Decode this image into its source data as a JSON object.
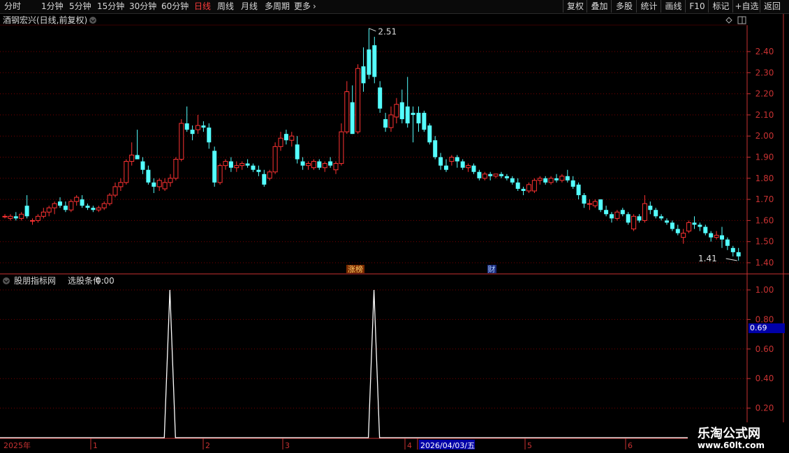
{
  "toolbar": {
    "periods": [
      "分时",
      "1分钟",
      "5分钟",
      "15分钟",
      "30分钟",
      "60分钟",
      "日线",
      "周线",
      "月线",
      "多周期",
      "更多"
    ],
    "active": "日线",
    "more_icon": "chevron-right-icon",
    "right_buttons": [
      "复权",
      "叠加",
      "多股",
      "统计",
      "画线",
      "F10",
      "标记",
      "+自选",
      "返回"
    ]
  },
  "main_panel": {
    "title": "酒钢宏兴(日线,前复权)",
    "title_icon": "chevron-down-icon",
    "controls": [
      "diamond-icon",
      "panel-toggle-icon"
    ],
    "y_ticks": [
      "2.40",
      "2.30",
      "2.20",
      "2.10",
      "2.00",
      "1.90",
      "1.80",
      "1.70",
      "1.60",
      "1.50",
      "1.40"
    ],
    "high_label": "2.51",
    "low_label": "1.41",
    "event_tags": [
      "涨榜",
      "财"
    ],
    "colors": {
      "up": "#ff3232",
      "down": "#54ffff",
      "grid": "#7a0000",
      "axis": "#c83232"
    }
  },
  "indicator_panel": {
    "title": "股朋指标网",
    "condition_label": "选股条件:",
    "condition_value": "0.00",
    "y_ticks": [
      "1.00",
      "0.80",
      "0.60",
      "0.40",
      "0.20"
    ],
    "crosshair_value": "0.69"
  },
  "time_axis": {
    "labels": [
      "2025年",
      "1",
      "2",
      "3",
      "4",
      "2026/04/03/五",
      "5",
      "6"
    ]
  },
  "watermark": {
    "title": "乐淘公式网",
    "url": "www.60lt.com"
  },
  "chart_data": [
    {
      "type": "candlestick",
      "title": "酒钢宏兴(日线,前复权)",
      "ylim": [
        1.37,
        2.52
      ],
      "high": 2.51,
      "low": 1.41,
      "candles": [
        [
          1.62,
          1.63,
          1.61,
          1.62
        ],
        [
          1.61,
          1.63,
          1.6,
          1.62
        ],
        [
          1.62,
          1.64,
          1.6,
          1.61
        ],
        [
          1.61,
          1.64,
          1.6,
          1.63
        ],
        [
          1.67,
          1.72,
          1.61,
          1.62
        ],
        [
          1.6,
          1.61,
          1.58,
          1.6
        ],
        [
          1.6,
          1.63,
          1.59,
          1.62
        ],
        [
          1.62,
          1.66,
          1.61,
          1.64
        ],
        [
          1.64,
          1.67,
          1.62,
          1.66
        ],
        [
          1.66,
          1.69,
          1.63,
          1.68
        ],
        [
          1.69,
          1.71,
          1.66,
          1.67
        ],
        [
          1.67,
          1.69,
          1.64,
          1.65
        ],
        [
          1.65,
          1.7,
          1.64,
          1.69
        ],
        [
          1.69,
          1.72,
          1.67,
          1.71
        ],
        [
          1.7,
          1.72,
          1.66,
          1.67
        ],
        [
          1.67,
          1.68,
          1.65,
          1.66
        ],
        [
          1.66,
          1.67,
          1.64,
          1.65
        ],
        [
          1.65,
          1.67,
          1.64,
          1.66
        ],
        [
          1.66,
          1.69,
          1.65,
          1.68
        ],
        [
          1.68,
          1.73,
          1.67,
          1.72
        ],
        [
          1.72,
          1.78,
          1.71,
          1.76
        ],
        [
          1.76,
          1.8,
          1.74,
          1.78
        ],
        [
          1.78,
          1.89,
          1.77,
          1.88
        ],
        [
          1.88,
          1.97,
          1.86,
          1.91
        ],
        [
          1.91,
          2.03,
          1.9,
          1.89
        ],
        [
          1.88,
          1.9,
          1.82,
          1.84
        ],
        [
          1.84,
          1.86,
          1.77,
          1.78
        ],
        [
          1.78,
          1.8,
          1.73,
          1.76
        ],
        [
          1.76,
          1.8,
          1.74,
          1.79
        ],
        [
          1.75,
          1.8,
          1.74,
          1.78
        ],
        [
          1.78,
          1.82,
          1.76,
          1.8
        ],
        [
          1.8,
          1.9,
          1.79,
          1.89
        ],
        [
          1.89,
          2.08,
          1.88,
          2.06
        ],
        [
          2.06,
          2.14,
          2.02,
          2.03
        ],
        [
          2.03,
          2.05,
          1.98,
          2.01
        ],
        [
          2.03,
          2.1,
          2.01,
          2.05
        ],
        [
          2.05,
          2.07,
          2.02,
          2.04
        ],
        [
          2.04,
          2.06,
          1.94,
          1.97
        ],
        [
          1.93,
          1.95,
          1.76,
          1.78
        ],
        [
          1.78,
          1.87,
          1.77,
          1.86
        ],
        [
          1.86,
          1.89,
          1.84,
          1.88
        ],
        [
          1.88,
          1.9,
          1.83,
          1.85
        ],
        [
          1.85,
          1.88,
          1.83,
          1.86
        ],
        [
          1.86,
          1.88,
          1.84,
          1.87
        ],
        [
          1.87,
          1.89,
          1.85,
          1.86
        ],
        [
          1.86,
          1.87,
          1.83,
          1.84
        ],
        [
          1.84,
          1.86,
          1.81,
          1.83
        ],
        [
          1.82,
          1.84,
          1.76,
          1.77
        ],
        [
          1.8,
          1.84,
          1.79,
          1.83
        ],
        [
          1.83,
          1.97,
          1.82,
          1.95
        ],
        [
          1.95,
          2.02,
          1.93,
          1.99
        ],
        [
          2.01,
          2.03,
          1.96,
          1.98
        ],
        [
          1.98,
          2.02,
          1.95,
          2.0
        ],
        [
          1.96,
          2.0,
          1.87,
          1.89
        ],
        [
          1.88,
          1.9,
          1.84,
          1.86
        ],
        [
          1.86,
          1.88,
          1.84,
          1.87
        ],
        [
          1.85,
          1.89,
          1.84,
          1.88
        ],
        [
          1.88,
          1.89,
          1.84,
          1.85
        ],
        [
          1.85,
          1.88,
          1.83,
          1.87
        ],
        [
          1.88,
          1.9,
          1.85,
          1.86
        ],
        [
          1.84,
          1.88,
          1.82,
          1.87
        ],
        [
          1.87,
          2.06,
          1.86,
          2.02
        ],
        [
          2.02,
          2.26,
          2.01,
          2.21
        ],
        [
          2.16,
          2.24,
          2.01,
          2.01
        ],
        [
          2.02,
          2.34,
          2.01,
          2.32
        ],
        [
          2.33,
          2.42,
          2.21,
          2.25
        ],
        [
          2.41,
          2.51,
          2.27,
          2.29
        ],
        [
          2.43,
          2.47,
          2.25,
          2.28
        ],
        [
          2.23,
          2.26,
          2.11,
          2.13
        ],
        [
          2.08,
          2.11,
          2.02,
          2.04
        ],
        [
          2.04,
          2.14,
          2.02,
          2.1
        ],
        [
          2.09,
          2.18,
          2.06,
          2.15
        ],
        [
          2.16,
          2.22,
          2.06,
          2.08
        ],
        [
          2.14,
          2.28,
          2.04,
          2.06
        ],
        [
          2.11,
          2.14,
          1.97,
          2.1
        ],
        [
          2.11,
          2.14,
          2.02,
          2.06
        ],
        [
          2.11,
          2.12,
          2.02,
          2.03
        ],
        [
          2.05,
          2.06,
          1.96,
          1.97
        ],
        [
          1.98,
          2.0,
          1.89,
          1.9
        ],
        [
          1.9,
          1.92,
          1.84,
          1.86
        ],
        [
          1.86,
          1.89,
          1.83,
          1.84
        ],
        [
          1.88,
          1.91,
          1.86,
          1.9
        ],
        [
          1.9,
          1.91,
          1.85,
          1.88
        ],
        [
          1.88,
          1.89,
          1.84,
          1.85
        ],
        [
          1.85,
          1.87,
          1.83,
          1.86
        ],
        [
          1.86,
          1.87,
          1.82,
          1.83
        ],
        [
          1.83,
          1.84,
          1.79,
          1.8
        ],
        [
          1.8,
          1.83,
          1.79,
          1.82
        ],
        [
          1.82,
          1.83,
          1.79,
          1.81
        ],
        [
          1.81,
          1.82,
          1.8,
          1.82
        ],
        [
          1.82,
          1.83,
          1.8,
          1.81
        ],
        [
          1.81,
          1.82,
          1.79,
          1.8
        ],
        [
          1.8,
          1.81,
          1.77,
          1.78
        ],
        [
          1.78,
          1.8,
          1.74,
          1.75
        ],
        [
          1.75,
          1.76,
          1.72,
          1.74
        ],
        [
          1.74,
          1.78,
          1.73,
          1.77
        ],
        [
          1.74,
          1.8,
          1.73,
          1.79
        ],
        [
          1.79,
          1.81,
          1.77,
          1.8
        ],
        [
          1.8,
          1.81,
          1.77,
          1.78
        ],
        [
          1.78,
          1.81,
          1.77,
          1.8
        ],
        [
          1.8,
          1.82,
          1.78,
          1.79
        ],
        [
          1.79,
          1.82,
          1.78,
          1.81
        ],
        [
          1.81,
          1.84,
          1.78,
          1.79
        ],
        [
          1.79,
          1.81,
          1.75,
          1.76
        ],
        [
          1.77,
          1.78,
          1.7,
          1.72
        ],
        [
          1.72,
          1.73,
          1.66,
          1.68
        ],
        [
          1.68,
          1.7,
          1.65,
          1.68
        ],
        [
          1.67,
          1.7,
          1.66,
          1.69
        ],
        [
          1.7,
          1.7,
          1.64,
          1.65
        ],
        [
          1.65,
          1.67,
          1.62,
          1.63
        ],
        [
          1.63,
          1.64,
          1.59,
          1.61
        ],
        [
          1.61,
          1.65,
          1.6,
          1.64
        ],
        [
          1.65,
          1.66,
          1.62,
          1.63
        ],
        [
          1.63,
          1.64,
          1.58,
          1.59
        ],
        [
          1.56,
          1.63,
          1.55,
          1.62
        ],
        [
          1.62,
          1.63,
          1.59,
          1.6
        ],
        [
          1.6,
          1.72,
          1.59,
          1.68
        ],
        [
          1.67,
          1.69,
          1.63,
          1.65
        ],
        [
          1.65,
          1.66,
          1.61,
          1.62
        ],
        [
          1.62,
          1.63,
          1.6,
          1.61
        ],
        [
          1.6,
          1.61,
          1.58,
          1.59
        ],
        [
          1.59,
          1.6,
          1.55,
          1.56
        ],
        [
          1.56,
          1.58,
          1.53,
          1.54
        ],
        [
          1.52,
          1.56,
          1.49,
          1.54
        ],
        [
          1.55,
          1.6,
          1.54,
          1.59
        ],
        [
          1.59,
          1.62,
          1.56,
          1.58
        ],
        [
          1.58,
          1.59,
          1.55,
          1.57
        ],
        [
          1.57,
          1.58,
          1.53,
          1.54
        ],
        [
          1.54,
          1.55,
          1.5,
          1.52
        ],
        [
          1.52,
          1.55,
          1.51,
          1.53
        ],
        [
          1.53,
          1.57,
          1.47,
          1.51
        ],
        [
          1.51,
          1.52,
          1.46,
          1.48
        ],
        [
          1.47,
          1.48,
          1.43,
          1.45
        ],
        [
          1.45,
          1.47,
          1.41,
          1.43
        ]
      ]
    },
    {
      "type": "line",
      "title": "股朋指标网",
      "ylim": [
        0,
        1.1
      ],
      "baseline": 0,
      "signals_at_candle": [
        27,
        64
      ],
      "signal_value": 1.0
    }
  ]
}
